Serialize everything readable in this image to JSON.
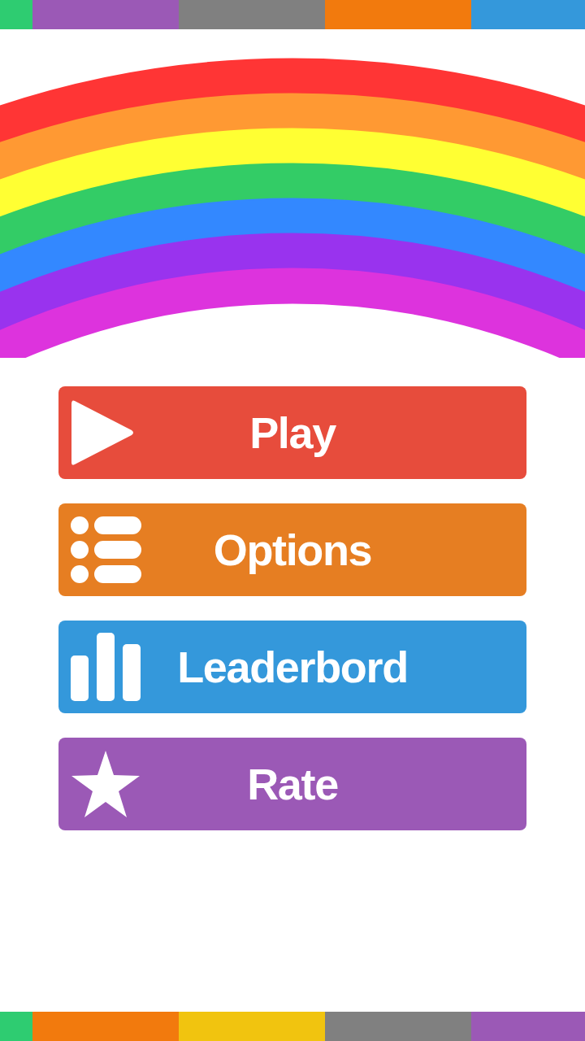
{
  "menu": [
    {
      "label": "Play",
      "kind": "play"
    },
    {
      "label": "Options",
      "kind": "list"
    },
    {
      "label": "Leaderbord",
      "kind": "chart"
    },
    {
      "label": "Rate",
      "kind": "star"
    }
  ]
}
